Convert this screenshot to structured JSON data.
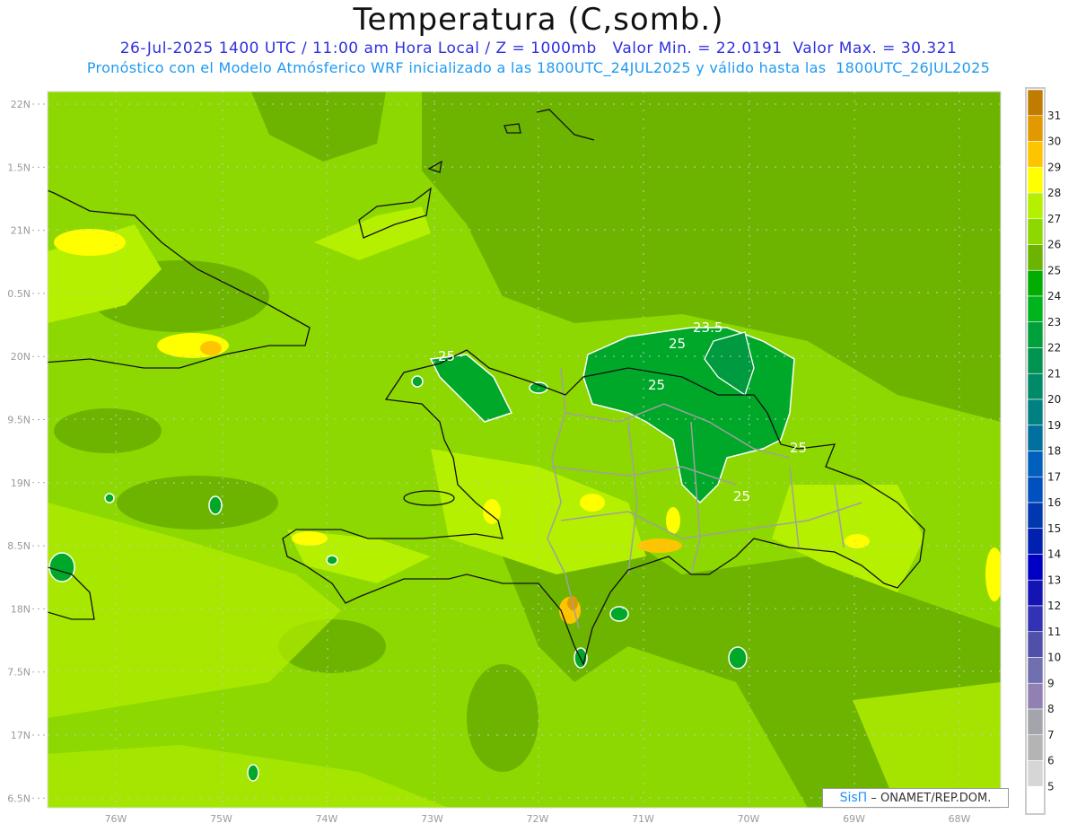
{
  "header": {
    "title": "Temperatura (C,somb.)",
    "subtitle1": "26-Jul-2025 1400 UTC / 11:00 am Hora Local / Z = 1000mb   Valor Min. = 22.0191  Valor Max. = 30.321",
    "subtitle2": "Pronóstico con el Modelo Atmósferico WRF inicializado a las 1800UTC_24JUL2025 y válido hasta las  1800UTC_26JUL2025"
  },
  "map": {
    "lat_labels": [
      "22N",
      "1.5N",
      "21N",
      "0.5N",
      "20N",
      "9.5N",
      "19N",
      "8.5N",
      "18N",
      "7.5N",
      "17N",
      "6.5N"
    ],
    "lon_labels": [
      "76W",
      "75W",
      "74W",
      "73W",
      "72W",
      "71W",
      "70W",
      "69W",
      "68W"
    ],
    "contour_labels": [
      "25",
      "23.5",
      "25",
      "25",
      "25",
      "25"
    ]
  },
  "colorbar": {
    "labels": [
      "31",
      "30",
      "29",
      "28",
      "27",
      "26",
      "25",
      "24",
      "23",
      "22",
      "21",
      "20",
      "19",
      "18",
      "17",
      "16",
      "15",
      "14",
      "13",
      "12",
      "11",
      "10",
      "9",
      "8",
      "7",
      "6",
      "5"
    ],
    "colors": [
      "#c07c00",
      "#e09a00",
      "#ffc400",
      "#ffff00",
      "#b4f000",
      "#8cd800",
      "#6cb400",
      "#00ad00",
      "#00b41e",
      "#00a03c",
      "#009450",
      "#008a68",
      "#008080",
      "#00709e",
      "#0060bc",
      "#0050c0",
      "#0038b0",
      "#0020b0",
      "#0000c4",
      "#1414b4",
      "#3232b4",
      "#5050aa",
      "#7070b0",
      "#9080b4",
      "#a4a4ac",
      "#b4b4b4",
      "#d6d6d6",
      "#ffffff"
    ]
  },
  "credit": {
    "logo": "SisΠ",
    "text": " – ONAMET/REP.DOM."
  },
  "palette": {
    "base": "#8cd800",
    "dark": "#6cb400",
    "light": "#b4f000",
    "cool": "#00a03c",
    "warm": "#ffc400"
  }
}
